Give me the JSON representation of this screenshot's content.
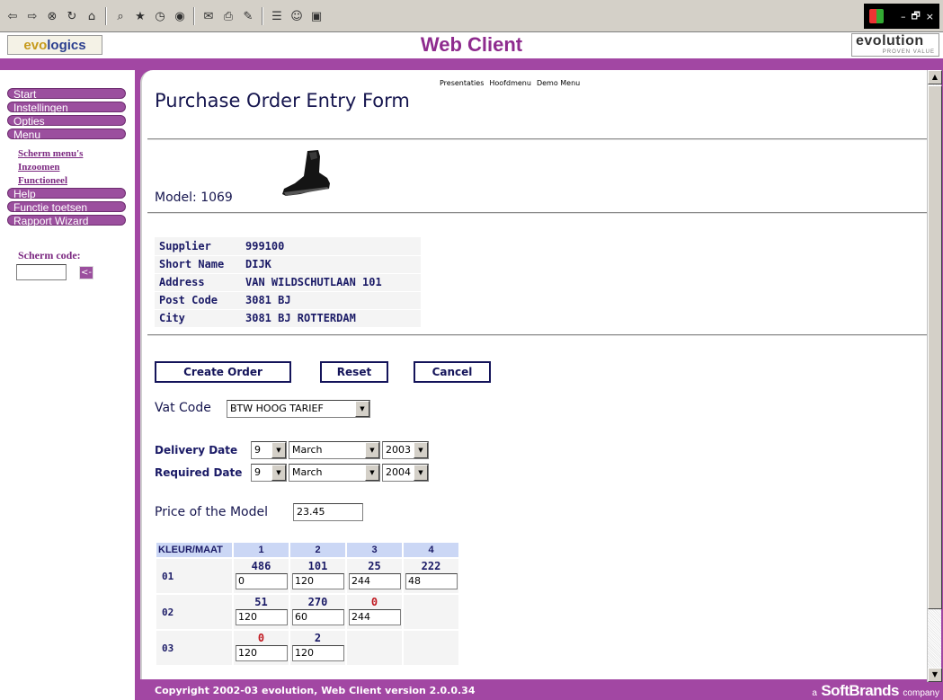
{
  "browser": {
    "toolbar_icons": [
      "back-arrow-icon",
      "forward-arrow-icon",
      "stop-icon",
      "refresh-icon",
      "home-icon",
      "search-icon",
      "favorites-icon",
      "history-icon",
      "mail-icon",
      "print-icon",
      "edit-icon",
      "discuss-icon",
      "messenger-icon",
      "fullscreen-icon"
    ],
    "window_controls": [
      "–",
      "🗗",
      "×"
    ]
  },
  "header": {
    "logo_left_a": "evo",
    "logo_left_b": "logics",
    "title": "Web Client",
    "logo_right_name": "evolution",
    "logo_right_tag": "PROVEN VALUE"
  },
  "sidebar": {
    "start": "Start",
    "instellingen": "Instellingen",
    "opties": "Opties",
    "menu": "Menu",
    "scherm_menus": "Scherm menu's",
    "inzoomen": "Inzoomen",
    "functioneel": "Functioneel",
    "help": "Help",
    "functie_toetsen": "Functie toetsen",
    "rapport_wizard": "Rapport Wizard",
    "scherm_code_label": "Scherm code:",
    "scherm_code_value": "",
    "scherm_go": "<-"
  },
  "top_links": {
    "presentaties": "Presentaties",
    "hoofdmenu": "Hoofdmenu",
    "demo_menu": "Demo Menu"
  },
  "page": {
    "title": "Purchase Order Entry Form",
    "model_label": "Model: 1069"
  },
  "supplier": {
    "supplier_label": "Supplier",
    "supplier_value": "999100",
    "short_name_label": "Short Name",
    "short_name_value": "DIJK",
    "address_label": "Address",
    "address_value": "VAN WILDSCHUTLAAN 101",
    "post_code_label": "Post Code",
    "post_code_value": "3081 BJ",
    "city_label": "City",
    "city_value": "3081 BJ ROTTERDAM"
  },
  "actions": {
    "create_order": "Create Order",
    "reset": "Reset",
    "cancel": "Cancel"
  },
  "vat": {
    "label": "Vat Code",
    "value": "BTW HOOG TARIEF"
  },
  "dates": {
    "delivery_label": "Delivery Date",
    "delivery_day": "9",
    "delivery_month": "March",
    "delivery_year": "2003",
    "required_label": "Required Date",
    "required_day": "9",
    "required_month": "March",
    "required_year": "2004"
  },
  "price": {
    "label": "Price of the Model",
    "value": "23.45"
  },
  "matrix": {
    "corner": "KLEUR/MAAT",
    "sizes": [
      "1",
      "2",
      "3",
      "4"
    ],
    "rows": [
      {
        "color": "01",
        "cells": [
          {
            "stock": "486",
            "qty": "0"
          },
          {
            "stock": "101",
            "qty": "120"
          },
          {
            "stock": "25",
            "qty": "244"
          },
          {
            "stock": "222",
            "qty": "48"
          }
        ]
      },
      {
        "color": "02",
        "cells": [
          {
            "stock": "51",
            "qty": "120"
          },
          {
            "stock": "270",
            "qty": "60"
          },
          {
            "stock": "0",
            "qty": "244"
          }
        ]
      },
      {
        "color": "03",
        "cells": [
          {
            "stock": "0",
            "qty": "120"
          },
          {
            "stock": "2",
            "qty": "120"
          }
        ]
      }
    ]
  },
  "footer": {
    "copyright": "Copyright 2002-03 evolution, Web Client version 2.0.0.34",
    "brand_a": "a",
    "brand_name": "SoftBrands",
    "brand_company": "company"
  },
  "colors": {
    "accent_purple": "#a247a3",
    "menu_purple": "#9b4f9e",
    "text_navy": "#1a1a66",
    "zero_stock_red": "#c0171f",
    "matrix_header_blue": "#cbd7f5"
  }
}
